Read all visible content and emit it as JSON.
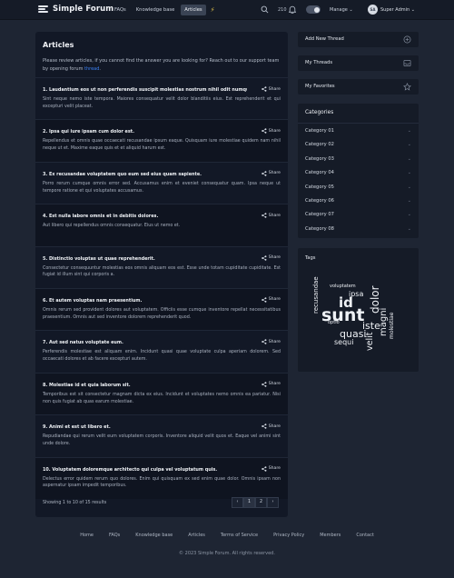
{
  "brand": {
    "name": "Simple Forum"
  },
  "nav": {
    "items": [
      "FAQs",
      "Knowledge base",
      "Articles"
    ],
    "active": "Articles"
  },
  "topbar": {
    "count": "210",
    "manage": "Manage",
    "avatar_initials": "SA",
    "user": "Super Admin"
  },
  "main": {
    "title": "Articles",
    "intro_text": "Please review articles, if you cannot find the answer you are looking for? Reach out to our support team by opening forum",
    "intro_link": "thread",
    "intro_end": ".",
    "share_label": "Share",
    "articles": [
      {
        "title": "1. Laudantium eos ut non perferendis suscipit molestias nostrum nihil odit numquam.",
        "excerpt": "Sint neque nemo iste tempora. Maiores consequatur velit dolor blanditiis eius. Est reprehenderit et qui excepturi velit placeat."
      },
      {
        "title": "2. Ipsa qui iure ipsam cum dolor est.",
        "excerpt": "Repellendus et omnis quae occaecati recusandae ipsum eaque. Quisquam iure molestiae quidem nam nihil neque ut et. Maxime eaque quis et et aliquid harum est."
      },
      {
        "title": "3. Ex recusandae voluptatem quo eum sed eius quam sapiente.",
        "excerpt": "Porro rerum cumque omnis error sed. Accusamus enim et eveniet consequatur quam. Ipsa neque ut tempore ratione et qui voluptates accusamus."
      },
      {
        "title": "4. Est nulla labore omnis et in debitis dolores.",
        "excerpt": "Aut libero qui repellendus omnis consequatur. Eius ut nemo et."
      },
      {
        "title": "5. Distinctio voluptas ut quae reprehenderit.",
        "excerpt": "Consectetur consequuntur molestias eos omnis aliquam eos est. Esse unde totam cupiditate cupiditate. Est fugiat id illum sint qui corporis a."
      },
      {
        "title": "6. Et autem voluptas nam praesentium.",
        "excerpt": "Omnis rerum sed provident dolores aut voluptatem. Officiis esse cumque inventore repellat necessitatibus praesentium. Omnis aut sed inventore dolorem reprehenderit quod."
      },
      {
        "title": "7. Aut sed natus voluptate eum.",
        "excerpt": "Perferendis molestiae est aliquam enim. Incidunt quasi quae voluptate culpa aperiam dolorem. Sed occaecati dolores et ab facere excepturi autem."
      },
      {
        "title": "8. Molestiae id et quia laborum sit.",
        "excerpt": "Temporibus est sit consectetur magnam dicta ex eius. Incidunt et voluptates nemo omnis ea pariatur. Nisi non quis fugiat ab quas earum molestiae."
      },
      {
        "title": "9. Animi et est ut libero et.",
        "excerpt": "Repudiandae qui rerum velit eum voluptatem corporis. Inventore aliquid velit quos et. Eaque vel animi sint unde dolore."
      },
      {
        "title": "10. Voluptatem doloremque architecto qui culpa vel voluptatum quis.",
        "excerpt": "Delectus error quidem rerum quo dolores. Enim qui quisquam ex sed enim quae dolor. Omnis ipsam non aspernatur ipsam impedit temporibus."
      }
    ],
    "pagination": {
      "info": "Showing 1 to 10 of 15 results",
      "prev": "‹",
      "pages": [
        "1",
        "2"
      ],
      "next": "›"
    }
  },
  "sidebar": {
    "add_thread": "Add New Thread",
    "my_threads": "My Threads",
    "my_favorites": "My Favorites",
    "categories_title": "Categories",
    "categories": [
      "Category 01",
      "Category 02",
      "Category 03",
      "Category 04",
      "Category 05",
      "Category 06",
      "Category 07",
      "Category 08"
    ],
    "tags_title": "Tags",
    "tags": [
      "voluptatem",
      "ipsa",
      "id",
      "dolor",
      "recusandae",
      "sunt",
      "magni",
      "iste",
      "optio",
      "quasi",
      "velit",
      "molestiae",
      "sequi"
    ]
  },
  "footer": {
    "links": [
      "Home",
      "FAQs",
      "Knowledge base",
      "Articles",
      "Terms of Service",
      "Privacy Policy",
      "Members",
      "Contact"
    ],
    "copyright": "© 2023 Simple Forum. All rights reserved."
  },
  "colors": {
    "link": "#3b82f6",
    "bolt": "#e1c04a",
    "background": "#1e2533",
    "panel": "#151b27"
  },
  "icons": [
    "menu-logo-icon",
    "bolt-icon",
    "search-icon",
    "bell-icon",
    "theme-toggle",
    "chevron-down-icon",
    "share-icon",
    "plus-circle-icon",
    "inbox-icon",
    "star-icon"
  ]
}
